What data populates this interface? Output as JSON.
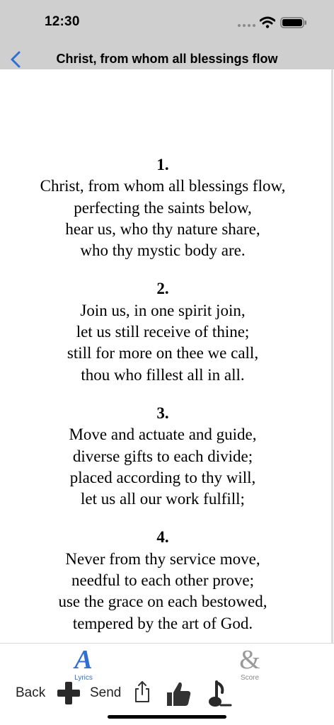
{
  "status_bar": {
    "time": "12:30"
  },
  "nav": {
    "title": "Christ, from whom all blessings flow"
  },
  "verses": [
    {
      "number": "1.",
      "lines": [
        "Christ, from whom all blessings flow,",
        "perfecting the saints below,",
        "hear us, who thy nature share,",
        "who thy mystic body are."
      ]
    },
    {
      "number": "2.",
      "lines": [
        "Join us, in one spirit join,",
        "let us still receive of thine;",
        "still for more on thee we call,",
        "thou who fillest all in all."
      ]
    },
    {
      "number": "3.",
      "lines": [
        "Move and actuate and guide,",
        "diverse gifts to each divide;",
        "placed according to thy will,",
        "let us all our work fulfill;"
      ]
    },
    {
      "number": "4.",
      "lines": [
        "Never from thy service move,",
        "needful to each other prove;",
        "use the grace on each bestowed,",
        "tempered by the art of God."
      ]
    }
  ],
  "tabs": [
    {
      "label": "Lyrics",
      "icon": "A",
      "selected": true
    },
    {
      "label": "Score",
      "icon": "&",
      "selected": false
    }
  ],
  "toolbar": {
    "back_label": "Back",
    "send_label": "Send"
  },
  "colors": {
    "accent": "#2f6fd3",
    "header_bg": "#cfcfcf"
  },
  "icons": [
    "signal-icon",
    "wifi-icon",
    "battery-icon",
    "back-chevron-icon",
    "plus-icon",
    "share-icon",
    "thumbs-up-icon",
    "music-note-icon"
  ]
}
